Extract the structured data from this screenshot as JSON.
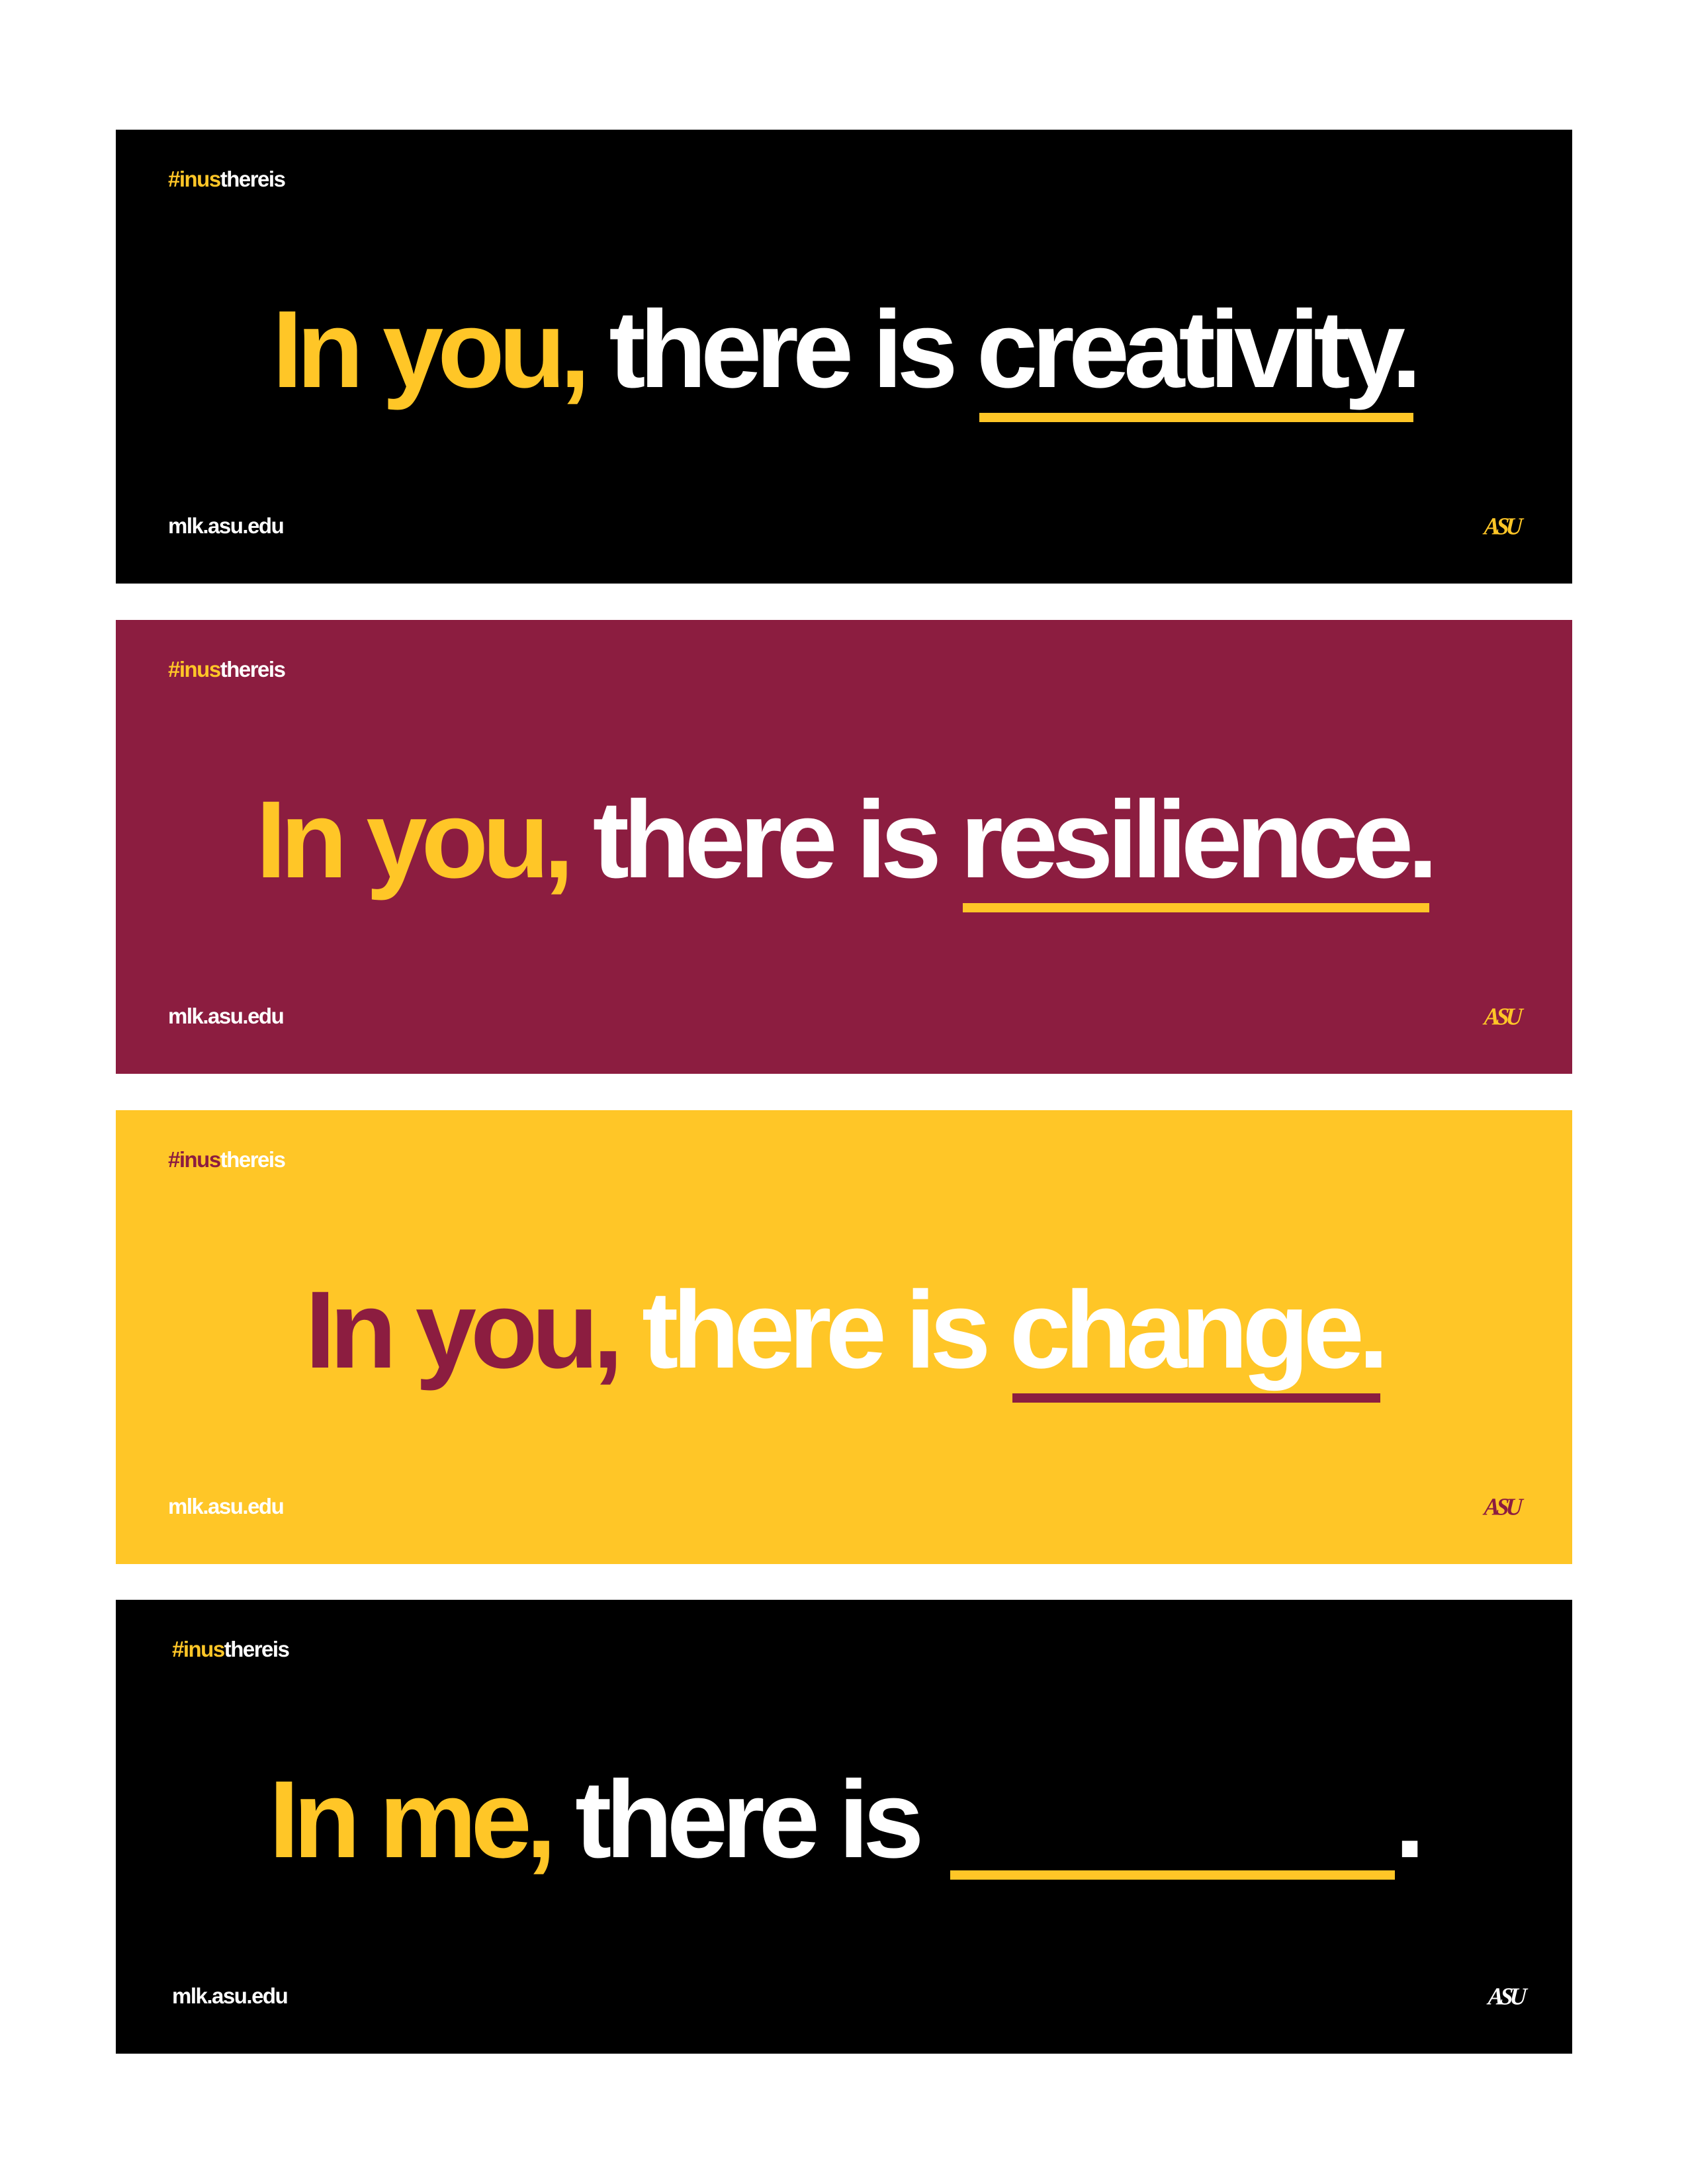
{
  "colors": {
    "black": "#000000",
    "maroon": "#8C1D40",
    "gold": "#FFC627",
    "white": "#FFFFFF"
  },
  "banners": [
    {
      "background": "#000000",
      "hashtag_part1": "#inus",
      "hashtag_part2": "thereis",
      "hashtag_color1": "#FFC627",
      "hashtag_color2": "#FFFFFF",
      "lead": "In you,",
      "lead_color": "#FFC627",
      "middle": "there is",
      "middle_color": "#FFFFFF",
      "word": "creativity.",
      "word_color": "#FFFFFF",
      "underline_color": "#FFC627",
      "url": "mlk.asu.edu",
      "url_color": "#FFFFFF",
      "logo": "ASU",
      "logo_color": "#FFC627"
    },
    {
      "background": "#8C1D40",
      "hashtag_part1": "#inus",
      "hashtag_part2": "thereis",
      "hashtag_color1": "#FFC627",
      "hashtag_color2": "#FFFFFF",
      "lead": "In you,",
      "lead_color": "#FFC627",
      "middle": "there is",
      "middle_color": "#FFFFFF",
      "word": "resilience.",
      "word_color": "#FFFFFF",
      "underline_color": "#FFC627",
      "url": "mlk.asu.edu",
      "url_color": "#FFFFFF",
      "logo": "ASU",
      "logo_color": "#FFC627"
    },
    {
      "background": "#FFC627",
      "hashtag_part1": "#inus",
      "hashtag_part2": "thereis",
      "hashtag_color1": "#8C1D40",
      "hashtag_color2": "#FFFFFF",
      "lead": "In you,",
      "lead_color": "#8C1D40",
      "middle": "there is",
      "middle_color": "#FFFFFF",
      "word": "change.",
      "word_color": "#FFFFFF",
      "underline_color": "#8C1D40",
      "url": "mlk.asu.edu",
      "url_color": "#FFFFFF",
      "logo": "ASU",
      "logo_color": "#8C1D40"
    },
    {
      "background": "#000000",
      "hashtag_part1": "#inus",
      "hashtag_part2": "thereis",
      "hashtag_color1": "#FFC627",
      "hashtag_color2": "#FFFFFF",
      "lead": "In me,",
      "lead_color": "#FFC627",
      "middle": "there is",
      "middle_color": "#FFFFFF",
      "blank_end": ".",
      "word_color": "#FFFFFF",
      "underline_color": "#FFC627",
      "url": "mlk.asu.edu",
      "url_color": "#FFFFFF",
      "logo": "ASU",
      "logo_color": "#FFFFFF"
    }
  ]
}
